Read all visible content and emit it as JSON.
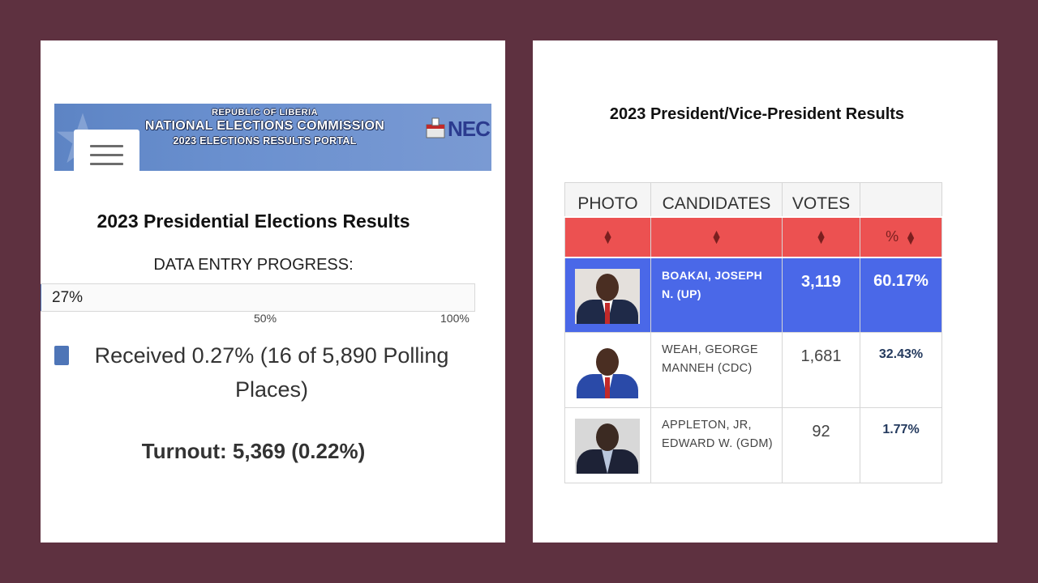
{
  "colors": {
    "background": "#5e3140",
    "banner_blue": "#5d84c4",
    "progress_fill": "#4e75b7",
    "sort_header_red": "#ec5151",
    "leader_row_blue": "#4a68e8"
  },
  "left_panel": {
    "banner": {
      "line1": "REPUBLIC OF LIBERIA",
      "line2": "NATIONAL ELECTIONS COMMISSION",
      "line3": "2023 ELECTIONS RESULTS PORTAL",
      "logo_text": "NEC"
    },
    "menu_icon": "hamburger-menu-icon",
    "title": "2023 Presidential Elections Results",
    "progress_label": "DATA ENTRY PROGRESS:",
    "progress_percent": 0.27,
    "progress_text": "27%",
    "ticks": [
      "50%",
      "100%"
    ],
    "received_text": "Received 0.27% (16 of 5,890 Polling Places)",
    "turnout_text": "Turnout: 5,369 (0.22%)"
  },
  "right_panel": {
    "title": "2023 President/Vice-President Results",
    "columns": [
      "PHOTO",
      "CANDIDATES",
      "VOTES",
      ""
    ],
    "sort_pct_label": "%",
    "sort_icon": "sort-arrows-icon",
    "rows": [
      {
        "name_line1": "BOAKAI, JOSEPH",
        "name_line2": "N. (UP)",
        "votes": "3,119",
        "pct": "60.17%",
        "photo": "candidate-photo-boakai"
      },
      {
        "name_line1": "WEAH, GEORGE",
        "name_line2": "MANNEH (CDC)",
        "votes": "1,681",
        "pct": "32.43%",
        "photo": "candidate-photo-weah"
      },
      {
        "name_line1": "APPLETON, JR,",
        "name_line2": "EDWARD W. (GDM)",
        "votes": "92",
        "pct": "1.77%",
        "photo": "candidate-photo-appleton"
      }
    ]
  }
}
